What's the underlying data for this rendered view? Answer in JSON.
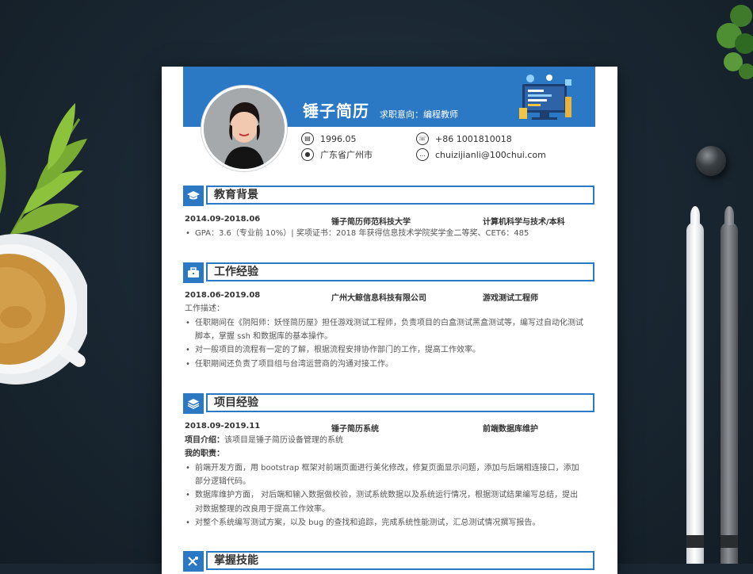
{
  "resume": {
    "name": "锤子简历",
    "intent": "求职意向：编程教师",
    "birth": "1996.05",
    "phone": "+86 1001810018",
    "location": "广东省广州市",
    "email": "chuizijianli@100chui.com"
  },
  "education": {
    "title": "教育背景",
    "period": "2014.09-2018.06",
    "school": "锤子简历师范科技大学",
    "major": "计算机科学与技术/本科",
    "detail": "GPA：3.6（专业前 10%）| 奖项证书：2018 年获得信息技术学院奖学金二等奖、CET6：485"
  },
  "work": {
    "title": "工作经验",
    "period": "2018.06-2019.08",
    "company": "广州大鲸信息科技有限公司",
    "position": "游戏测试工程师",
    "desc_label": "工作描述：",
    "bullets": [
      "任职期间在《阴阳师：妖怪简历屋》担任游戏测试工程师，负责项目的白盒测试黑盒测试等，编写过自动化测试",
      "脚本，掌握 ssh 和数据库的基本操作。",
      "对一般项目的流程有一定的了解，根据流程安排协作部门的工作，提高工作效率。",
      "任职期间还负责了项目组与台湾运营商的沟通对接工作。"
    ]
  },
  "project": {
    "title": "项目经验",
    "period": "2018.09-2019.11",
    "name": "锤子简历系统",
    "role": "前端数据库维护",
    "intro_label": "项目介绍：",
    "intro": "该项目是锤子简历设备管理的系统",
    "duty_label": "我的职责：",
    "bullets": [
      "前端开发方面，用 bootstrap 框架对前端页面进行美化修改，修复页面显示问题，添加与后端相连接口，添加",
      "部分逻辑代码。",
      "数据库维护方面，  对后端和输入数据做校验，测试系统数据以及系统运行情况，根据测试结果编写总结，提出",
      "对数据整理的改良用于提高工作效率。",
      "对整个系统编写测试方案，以及 bug 的查找和追踪，完成系统性能测试，汇总测试情况撰写报告。"
    ]
  },
  "skills": {
    "title": "掌握技能"
  },
  "colors": {
    "accent": "#2b78c5"
  },
  "icons": [
    "graduation-cap-icon",
    "briefcase-icon",
    "layers-icon",
    "tools-icon",
    "calendar-icon",
    "phone-icon",
    "location-icon",
    "chat-icon"
  ]
}
